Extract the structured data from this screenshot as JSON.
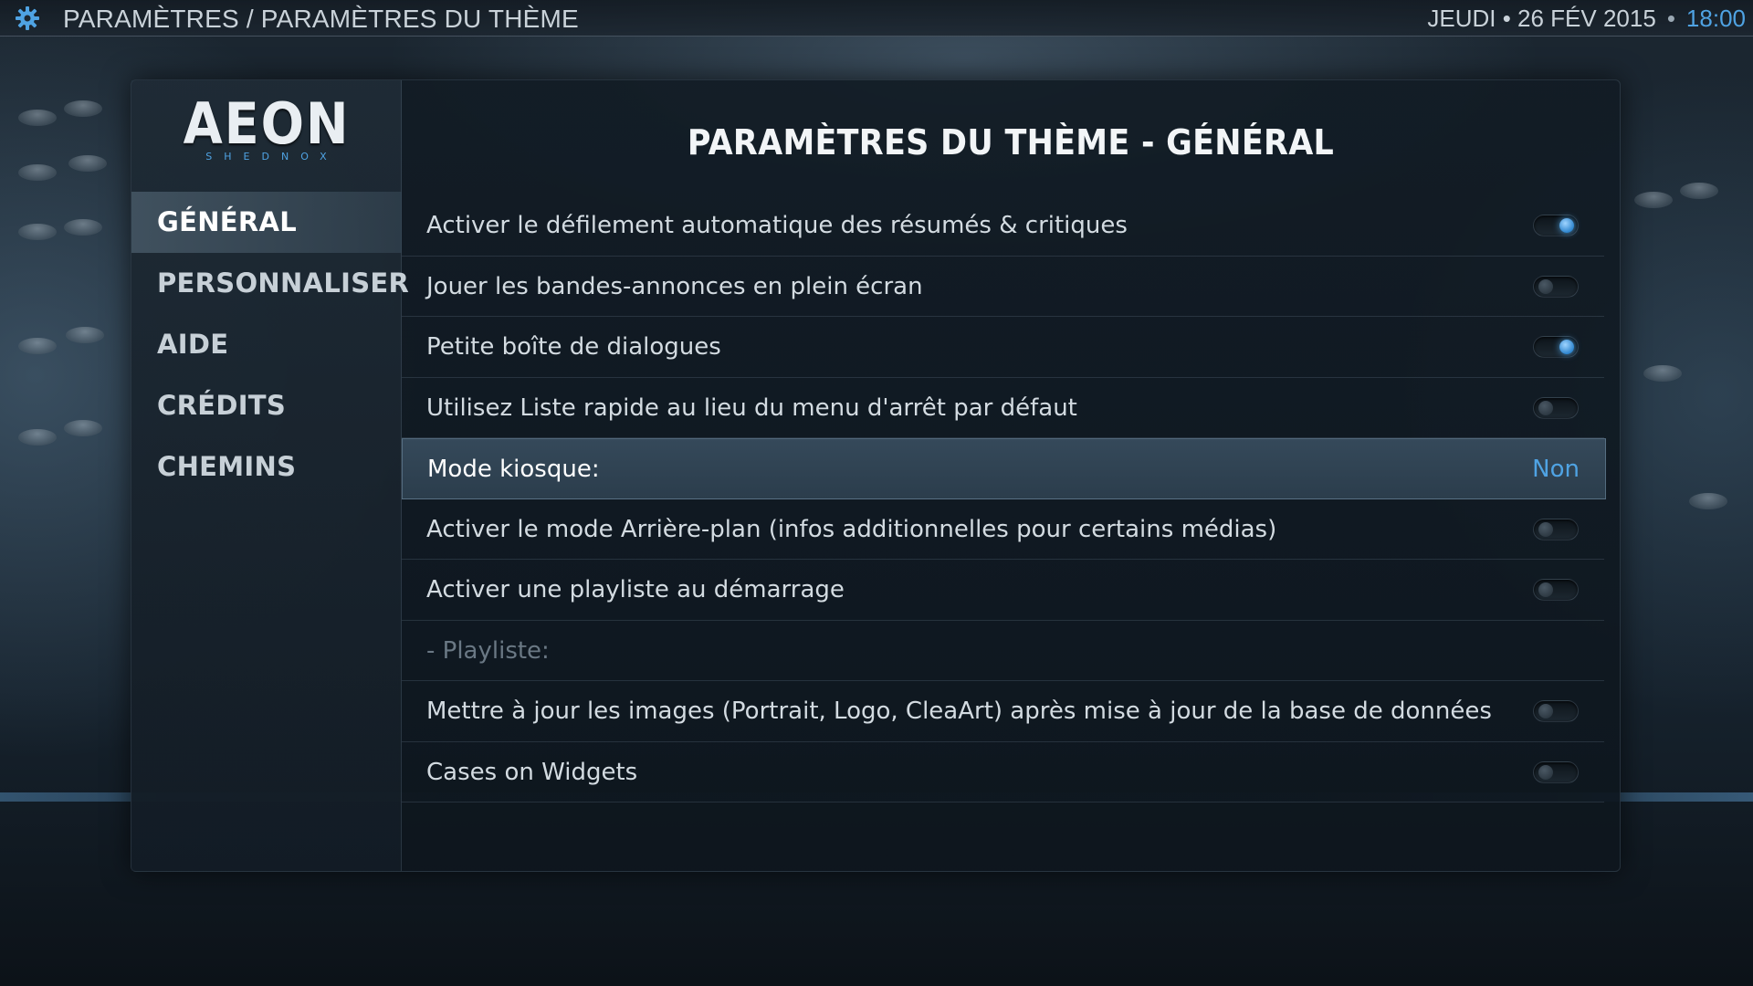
{
  "topbar": {
    "breadcrumb": "PARAMÈTRES / PARAMÈTRES DU THÈME",
    "date": "JEUDI • 26 FÉV 2015",
    "separator": "•",
    "time": "18:00"
  },
  "logo": {
    "main": "AEON",
    "sub": "SHEDNOX"
  },
  "sidebar": {
    "items": [
      {
        "label": "GÉNÉRAL",
        "active": true
      },
      {
        "label": "PERSONNALISER",
        "active": false
      },
      {
        "label": "AIDE",
        "active": false
      },
      {
        "label": "CRÉDITS",
        "active": false
      },
      {
        "label": "CHEMINS",
        "active": false
      }
    ]
  },
  "main": {
    "title": "PARAMÈTRES DU THÈME - GÉNÉRAL",
    "settings": [
      {
        "label": "Activer le défilement automatique des résumés & critiques",
        "type": "toggle",
        "on": true
      },
      {
        "label": "Jouer les bandes-annonces en plein écran",
        "type": "toggle",
        "on": false
      },
      {
        "label": "Petite boîte de dialogues",
        "type": "toggle",
        "on": true
      },
      {
        "label": "Utilisez Liste rapide au lieu du menu d'arrêt par défaut",
        "type": "toggle",
        "on": false
      },
      {
        "label": "Mode kiosque:",
        "type": "value",
        "value": "Non",
        "focused": true
      },
      {
        "label": "Activer le mode Arrière-plan (infos additionnelles pour certains médias)",
        "type": "toggle",
        "on": false
      },
      {
        "label": "Activer une playliste au démarrage",
        "type": "toggle",
        "on": false
      },
      {
        "label": "- Playliste:",
        "type": "disabled"
      },
      {
        "label": "Mettre à jour les images (Portrait, Logo, CleaArt) après mise à jour de la base de données",
        "type": "toggle",
        "on": false
      },
      {
        "label": "Cases on Widgets",
        "type": "toggle",
        "on": false
      }
    ]
  },
  "colors": {
    "accent": "#4fa3e3",
    "panel": "#121c25",
    "text": "#d3dbe1"
  }
}
